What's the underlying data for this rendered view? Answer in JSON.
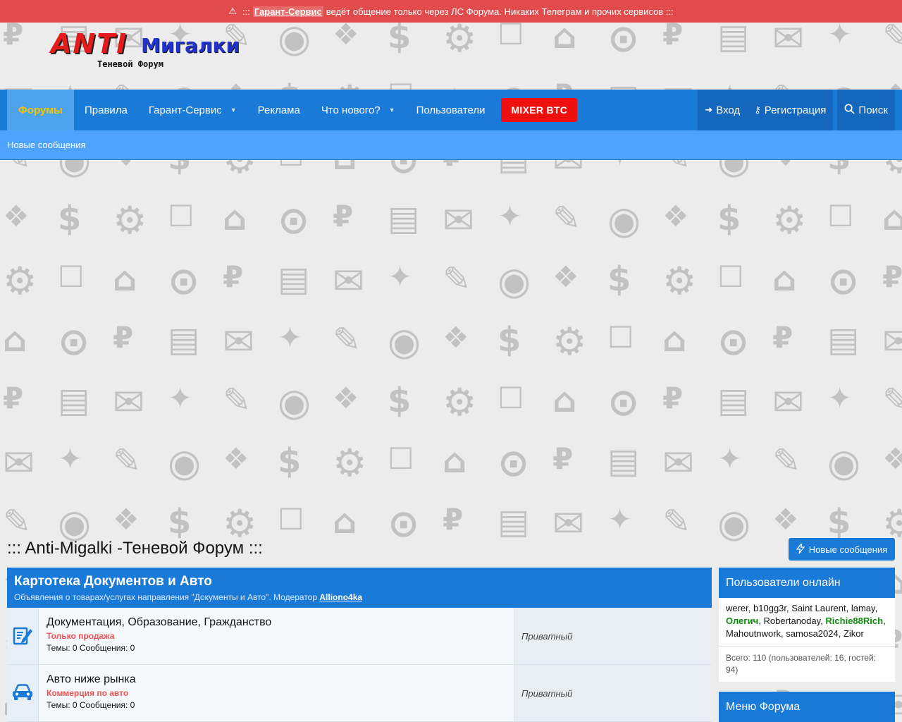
{
  "notice": {
    "prefix": ":::",
    "link": "Гарант-Сервис",
    "text": "ведёт общение только через ЛС Форума. Никаких Телеграм и прочих сервисов :::"
  },
  "logo": {
    "anti": "ANTI",
    "migalki": "Мигалки",
    "sub": "Теневой Форум"
  },
  "nav": {
    "items": [
      {
        "label": "Форумы"
      },
      {
        "label": "Правила"
      },
      {
        "label": "Гарант-Сервис"
      },
      {
        "label": "Реклама"
      },
      {
        "label": "Что нового?"
      },
      {
        "label": "Пользователи"
      }
    ],
    "mixer": "MIXER BTC",
    "login": "Вход",
    "register": "Регистрация",
    "search": "Поиск"
  },
  "subnav": {
    "new_posts": "Новые сообщения"
  },
  "page": {
    "title": "::: Anti-Migalki -Теневой Форум :::",
    "new_posts_button": "Новые сообщения"
  },
  "category": {
    "title": "Картотека Документов и Авто",
    "desc": "Объявления о товарах/услугах направления \"Документы и Авто\". Модератор",
    "moderator": "Alliono4ka",
    "forums": [
      {
        "title": "Документация, Образование, Гражданство",
        "tag": "Только продажа",
        "stats": "Темы: 0 Сообщения: 0",
        "last": "Приватный",
        "icon": "document-edit-icon"
      },
      {
        "title": "Авто ниже рынка",
        "tag": "Коммерция по авто",
        "stats": "Темы: 0 Сообщения: 0",
        "last": "Приватный",
        "icon": "car-icon"
      }
    ]
  },
  "sidebar": {
    "online_title": "Пользователи онлайн",
    "online_users": [
      {
        "name": "werer",
        "staff": false
      },
      {
        "name": "b10gg3r",
        "staff": false
      },
      {
        "name": "Saint Laurent",
        "staff": false
      },
      {
        "name": "lamay",
        "staff": false
      },
      {
        "name": "Олегич",
        "staff": true
      },
      {
        "name": "Robertanoday",
        "staff": false
      },
      {
        "name": "Richie88Rich",
        "staff": true
      },
      {
        "name": "Mahoutnwork",
        "staff": false
      },
      {
        "name": "samosa2024",
        "staff": false
      },
      {
        "name": "Zikor",
        "staff": false
      }
    ],
    "online_total": "Всего: 110 (пользователей: 16, гостей: 94)",
    "menu_title": "Меню Форума"
  },
  "colors": {
    "accent": "#1a7ad8",
    "notice": "#e14b4b",
    "mixer": "#ee0f0f",
    "active_nav_text": "#f7c400"
  }
}
